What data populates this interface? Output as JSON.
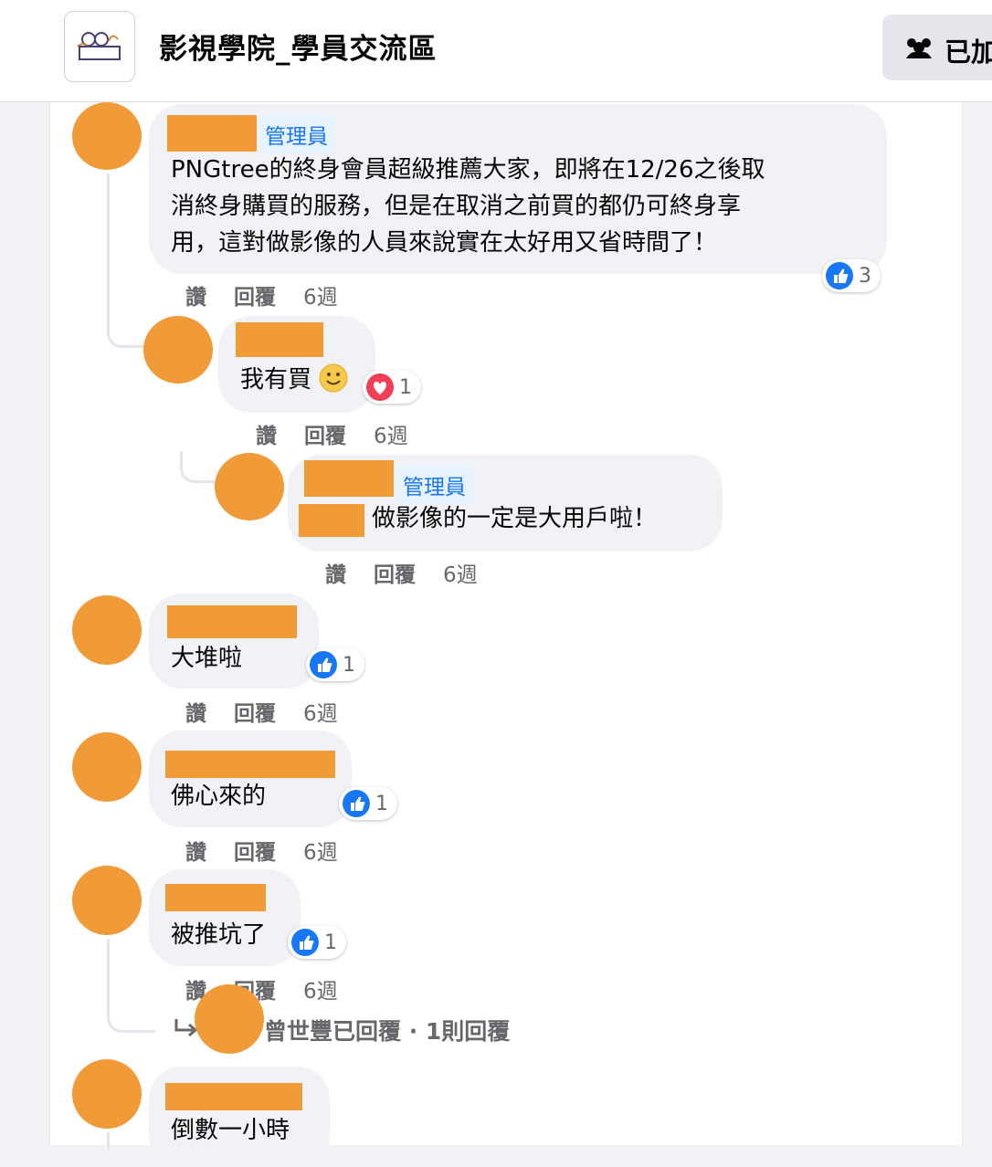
{
  "header": {
    "group_title": "影視學院_學員交流區",
    "joined_label": "已加",
    "logo_text": "影視學院"
  },
  "comments": [
    {
      "badge": "管理員",
      "text_lines": [
        "PNGtree的終身會員超級推薦大家，即將在12/26之後取",
        "消終身購買的服務，但是在取消之前買的都仍可終身享",
        "用，這對做影像的人員來說實在太好用又省時間了！"
      ],
      "reaction": {
        "icon": "like-icon",
        "count": "3"
      },
      "actions": {
        "like": "讚",
        "reply": "回覆",
        "time": "6週"
      }
    },
    {
      "text": "我有買",
      "reaction": {
        "icon": "love-icon",
        "count": "1"
      },
      "actions": {
        "like": "讚",
        "reply": "回覆",
        "time": "6週"
      }
    },
    {
      "badge": "管理員",
      "text": "做影像的一定是大用戶啦！",
      "actions": {
        "like": "讚",
        "reply": "回覆",
        "time": "6週"
      }
    },
    {
      "text": "大堆啦",
      "reaction": {
        "icon": "like-icon",
        "count": "1"
      },
      "actions": {
        "like": "讚",
        "reply": "回覆",
        "time": "6週"
      }
    },
    {
      "text": "佛心來的",
      "reaction": {
        "icon": "like-icon",
        "count": "1"
      },
      "actions": {
        "like": "讚",
        "reply": "回覆",
        "time": "6週"
      }
    },
    {
      "text": "被推坑了",
      "reaction": {
        "icon": "like-icon",
        "count": "1"
      },
      "actions": {
        "like": "讚",
        "reply": "回覆",
        "time": "6週"
      },
      "replies_summary": "曾世豐已回覆 · 1則回覆"
    },
    {
      "text": "倒數一小時"
    }
  ],
  "colors": {
    "redaction": "#f19a38",
    "like_blue": "#1877f2",
    "love_red": "#f33e58",
    "badge_text": "#1876f2"
  }
}
